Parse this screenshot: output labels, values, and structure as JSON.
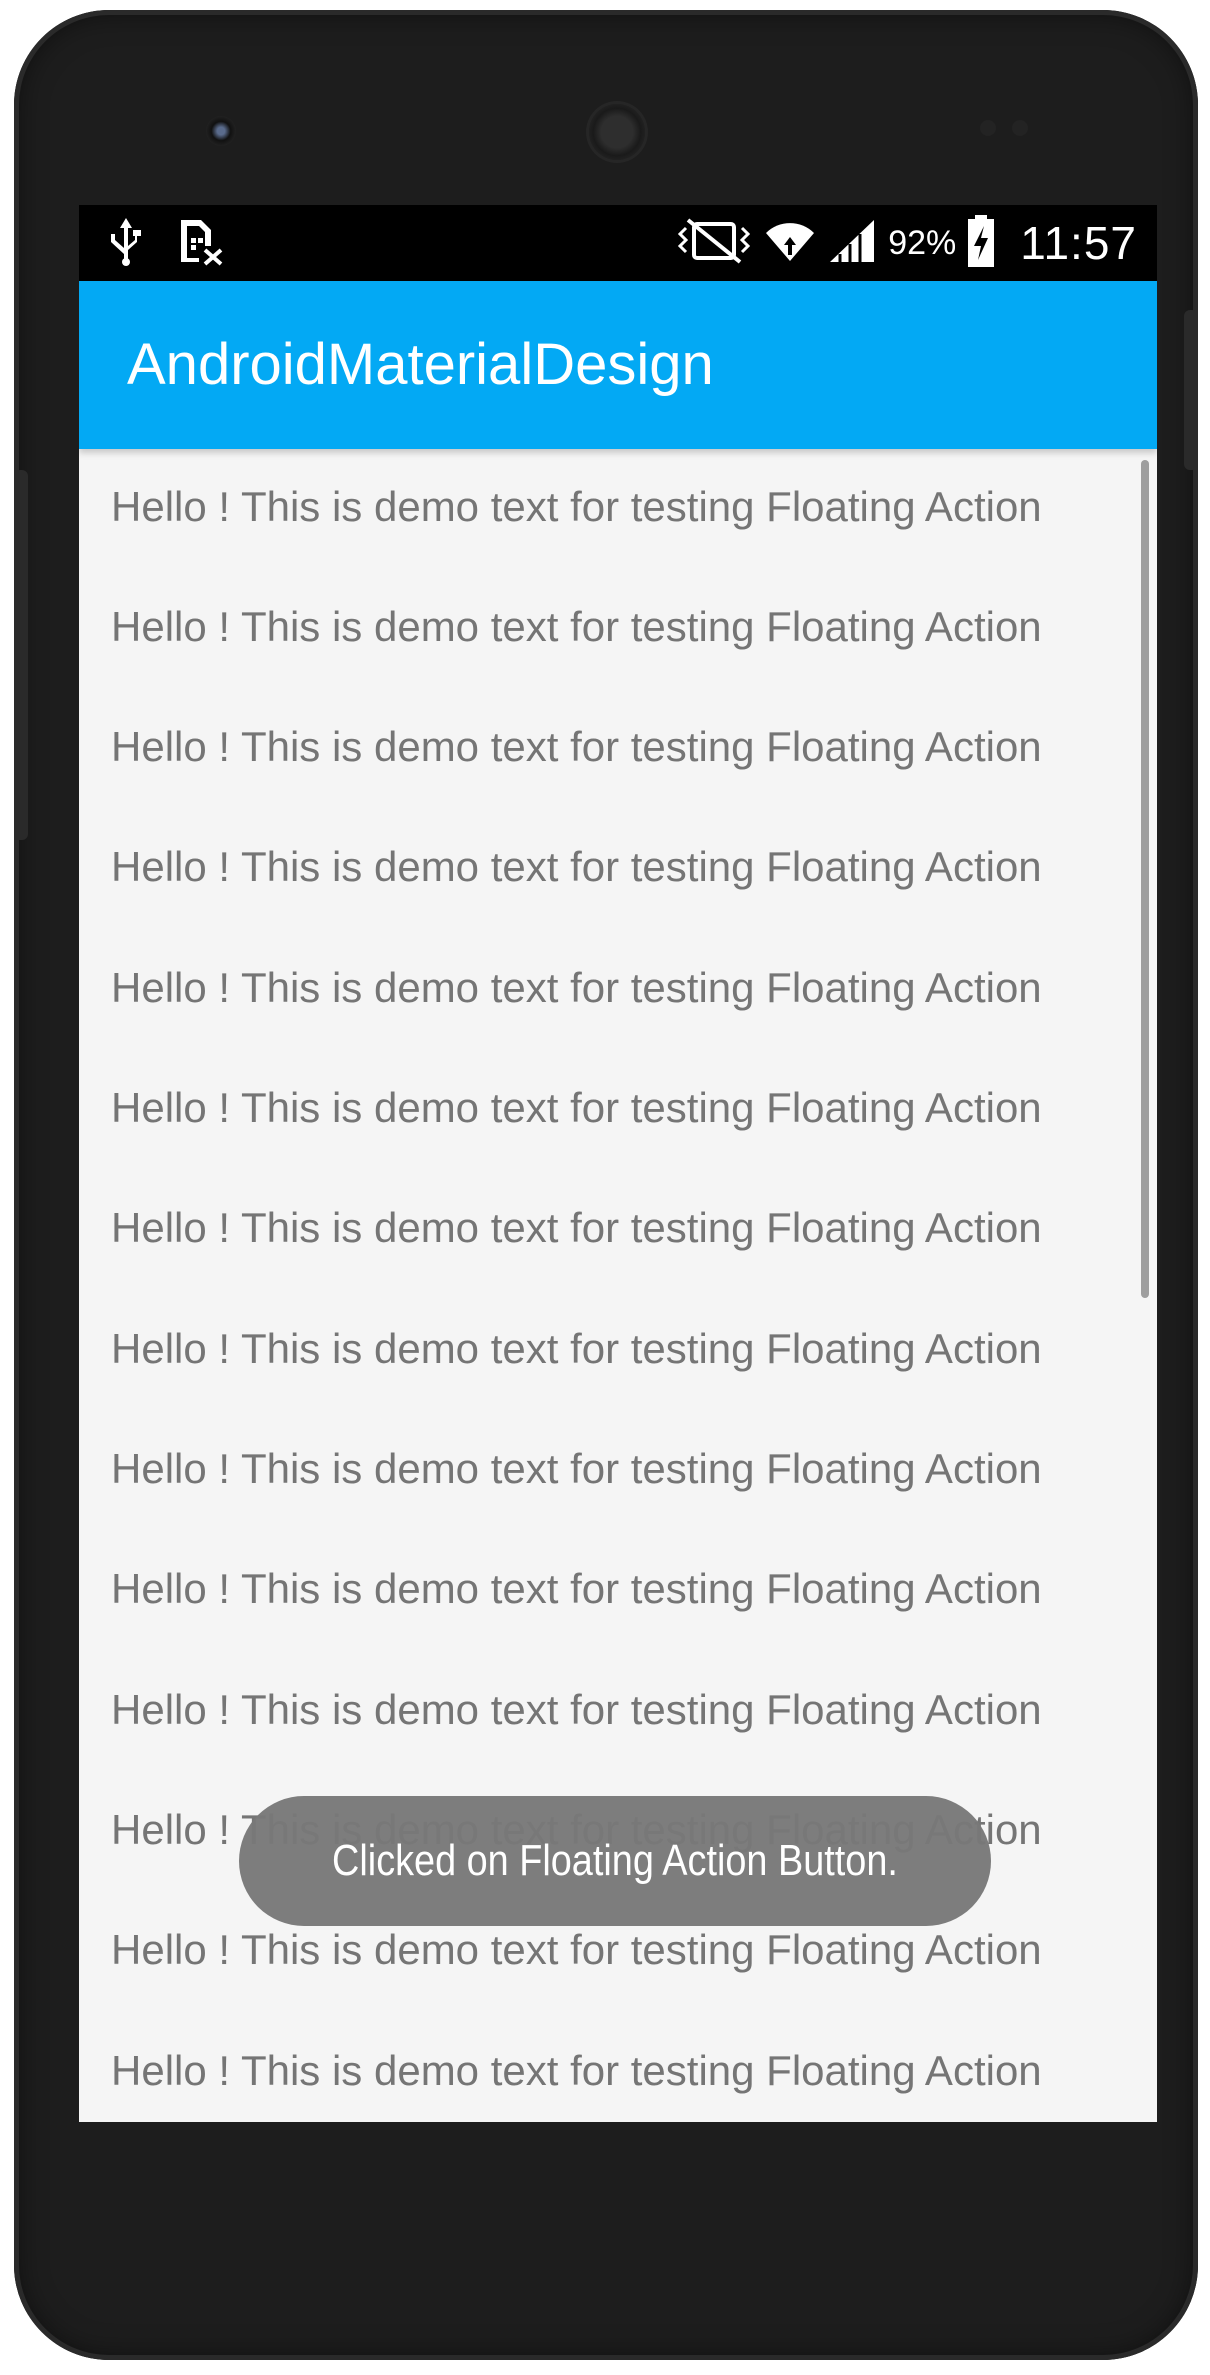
{
  "status_bar": {
    "left_icons": [
      "usb-icon",
      "sim-card-missing-icon"
    ],
    "right_icons": [
      "vibrate-icon",
      "wifi-icon",
      "cell-signal-icon",
      "battery-charging-icon"
    ],
    "battery_percent": "92%",
    "time": "11:57"
  },
  "app_bar": {
    "title": "AndroidMaterialDesign",
    "color": "#03a9f4"
  },
  "list": {
    "items": [
      "Hello ! This is demo text for testing Floating Action",
      "Hello ! This is demo text for testing Floating Action",
      "Hello ! This is demo text for testing Floating Action",
      "Hello ! This is demo text for testing Floating Action",
      "Hello ! This is demo text for testing Floating Action",
      "Hello ! This is demo text for testing Floating Action",
      "Hello ! This is demo text for testing Floating Action",
      "Hello ! This is demo text for testing Floating Action",
      "Hello ! This is demo text for testing Floating Action",
      "Hello ! This is demo text for testing Floating Action",
      "Hello ! This is demo text for testing Floating Action",
      "Hello ! This is demo text for testing Floating Action",
      "Hello ! This is demo text for testing Floating Action",
      "Hello ! This is demo text for testing Floating Action"
    ]
  },
  "toast": {
    "message": "Clicked on Floating Action Button."
  }
}
